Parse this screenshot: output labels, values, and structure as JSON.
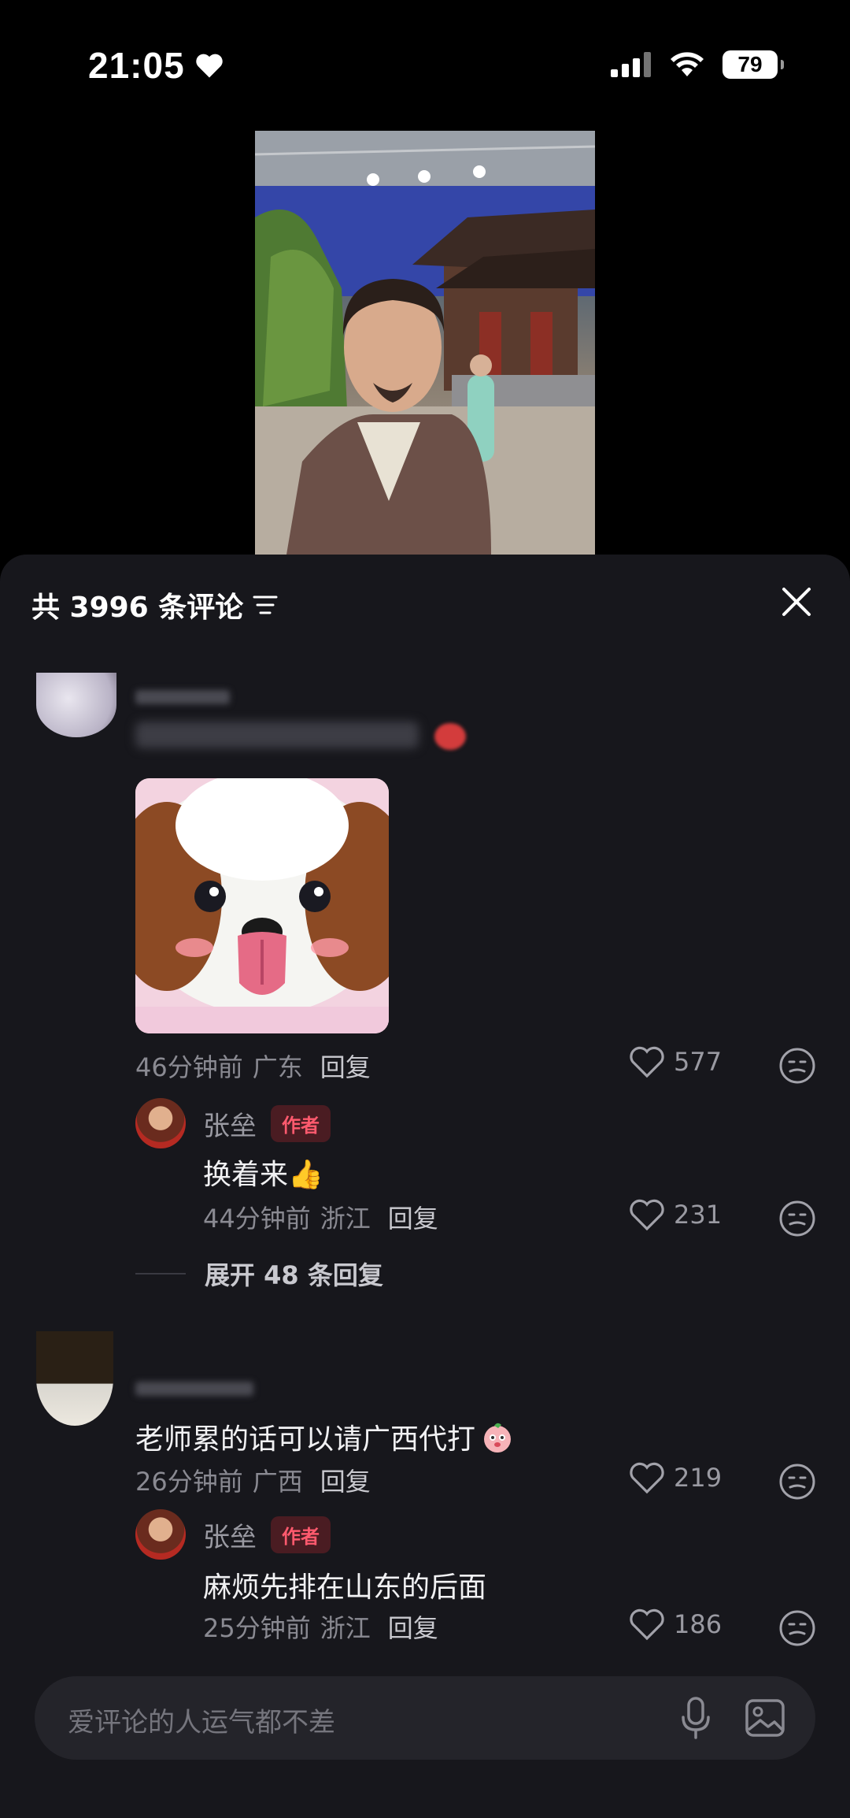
{
  "status_bar": {
    "time": "21:05",
    "battery": "79"
  },
  "comments_panel": {
    "title": "共 3996 条评论",
    "comments": [
      {
        "time": "46分钟前",
        "location": "广东",
        "reply_label": "回复",
        "likes": "577",
        "replies": [
          {
            "author": "张垒",
            "badge": "作者",
            "text": "换着来👍",
            "time": "44分钟前",
            "location": "浙江",
            "reply_label": "回复",
            "likes": "231"
          }
        ],
        "expand_label": "展开 48 条回复"
      },
      {
        "text": "老师累的话可以请广西代打",
        "time": "26分钟前",
        "location": "广西",
        "reply_label": "回复",
        "likes": "219",
        "replies": [
          {
            "author": "张垒",
            "badge": "作者",
            "text": "麻烦先排在山东的后面",
            "time": "25分钟前",
            "location": "浙江",
            "reply_label": "回复",
            "likes": "186"
          }
        ]
      }
    ]
  },
  "input": {
    "placeholder": "爱评论的人运气都不差"
  },
  "icons": [
    "heart-icon",
    "signal-icon",
    "wifi-icon",
    "battery-icon",
    "filter-icon",
    "close-icon",
    "like-heart-icon",
    "emoji-reaction-icon",
    "microphone-icon",
    "image-icon"
  ]
}
